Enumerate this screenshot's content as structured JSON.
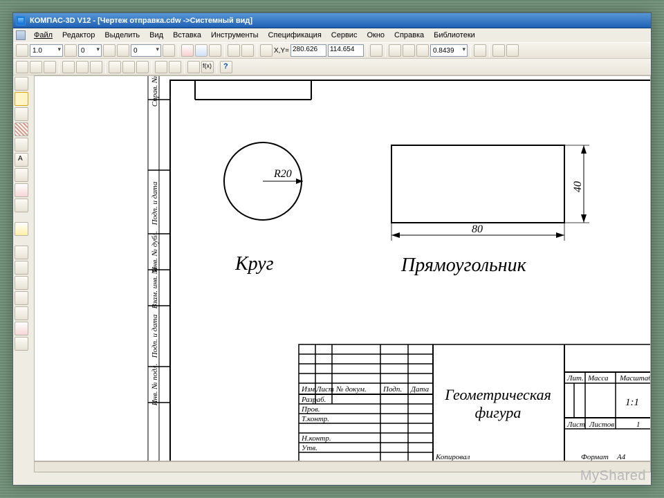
{
  "title": "КОМПАС-3D V12 - [Чертеж отправка.cdw ->Системный вид]",
  "menu": [
    "Файл",
    "Редактор",
    "Выделить",
    "Вид",
    "Вставка",
    "Инструменты",
    "Спецификация",
    "Сервис",
    "Окно",
    "Справка",
    "Библиотеки"
  ],
  "toolbar1": {
    "scale": "1.0",
    "spin1": "0",
    "spin2": "0",
    "coordLabel": "X,Y=",
    "coordX": "280.626",
    "coordY": "114.654",
    "zoom": "0.8439"
  },
  "drawing": {
    "circle_radius_label": "R20",
    "circle_title": "Круг",
    "rect_title": "Прямоугольник",
    "rect_w": "80",
    "rect_h": "40"
  },
  "titleblock": {
    "name_l1": "Геометрическая",
    "name_l2": "фигура",
    "cols_top": [
      "Лит.",
      "Масса",
      "Масштаб"
    ],
    "scaleval": "1:1",
    "sheet_l": "Лист",
    "sheets_l": "Листов",
    "sheets_v": "1",
    "rows_left_h": [
      "Изм.",
      "Лист",
      "№ докум.",
      "Подп.",
      "Дата"
    ],
    "rows_left": [
      "Разраб.",
      "Пров.",
      "Т.контр.",
      "",
      "Н.контр.",
      "Утв."
    ],
    "format": "Формат",
    "format_v": "А4",
    "kopir": "Копировал"
  },
  "sidecol": [
    "Справ. №",
    "",
    "Подп. и дата",
    "Инв. № дубл.",
    "Взам. инв. №",
    "Подп. и дата",
    "Инв. № подл."
  ],
  "watermark": "MyShared"
}
